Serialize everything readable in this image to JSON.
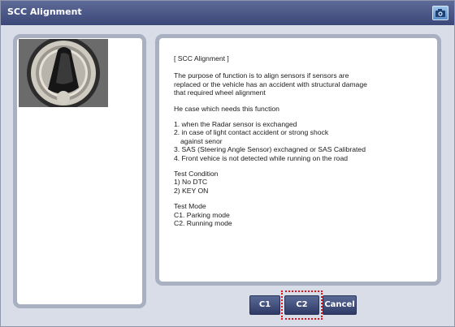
{
  "window": {
    "title": "SCC Alignment"
  },
  "icons": {
    "camera": "camera-icon"
  },
  "content": {
    "heading": "[ SCC Alignment ]",
    "purpose_lines": [
      "The purpose of function is to align sensors if sensors are",
      "replaced or the vehicle has an accident with structural damage",
      "that required wheel alignment"
    ],
    "needs_heading": "He case which needs this function",
    "cases": [
      "1. when the Radar sensor is exchanged",
      "2. in case of light contact accident or strong shock",
      "against senor",
      "3. SAS (Steering Angle Sensor) exchagned or SAS Calibrated",
      "4. Front vehice is not detected while running on the road"
    ],
    "test_condition": {
      "label": "Test Condition",
      "items": [
        "1) No DTC",
        "2) KEY ON"
      ]
    },
    "test_mode": {
      "label": "Test Mode",
      "items": [
        "C1. Parking mode",
        "C2. Running mode"
      ]
    }
  },
  "buttons": {
    "c1": "C1",
    "c2": "C2",
    "cancel": "Cancel"
  },
  "colors": {
    "titlebar": "#3a4778",
    "panel_border": "#a8b0c2",
    "button": "#2f3b66",
    "highlight": "#e0141b"
  }
}
